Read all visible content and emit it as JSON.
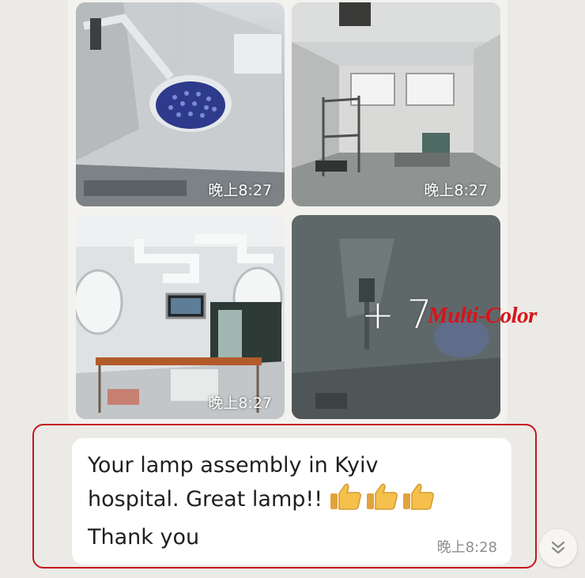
{
  "media_message": {
    "photos": [
      {
        "icon": "operating-lamp-ceiling-photo",
        "time": "晚上8:27"
      },
      {
        "icon": "empty-operating-room-photo",
        "time": "晚上8:27"
      },
      {
        "icon": "surgical-lights-room-photo",
        "time": "晚上8:27"
      },
      {
        "icon": "more-photos-thumbnail",
        "more_count": "+ 7"
      }
    ]
  },
  "watermark": {
    "text": "Multi-Color",
    "color": "#d6141b"
  },
  "text_message": {
    "line1": "Your lamp assembly in Kyiv",
    "line2": "hospital. Great lamp!!",
    "line3": "Thank you",
    "emoji": "thumbs-up-icon",
    "emoji_count": 3,
    "time": "晚上8:28"
  },
  "highlight_color": "#c6161c",
  "scroll_button": {
    "icon": "double-chevron-down-icon"
  }
}
